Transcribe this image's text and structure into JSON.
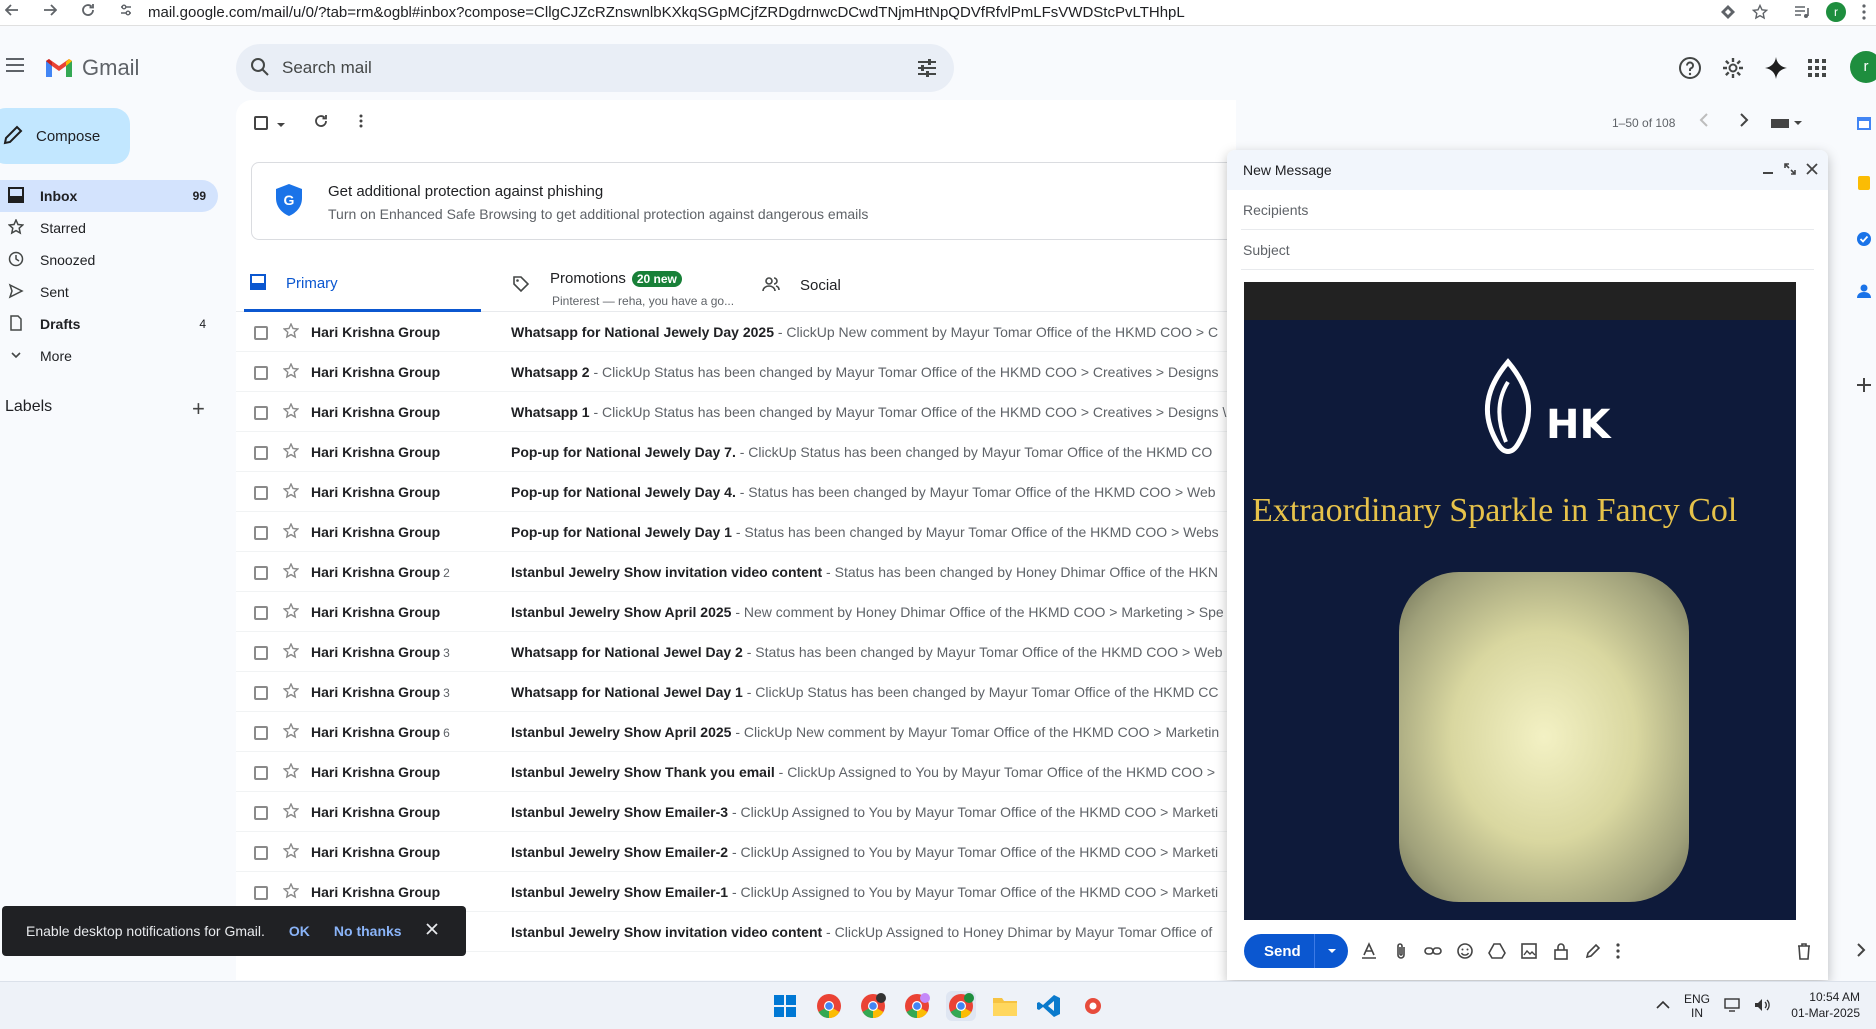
{
  "browser": {
    "url": "mail.google.com/mail/u/0/?tab=rm&ogbl#inbox?compose=CllgCJZcRZnswnlbKXkqSGpMCjfZRDgdrnwcDCwdTNjmHtNpQDVfRfvlPmLFsVWDStcPvLTHhpL",
    "avatar_letter": "r"
  },
  "app": {
    "name": "Gmail",
    "search_placeholder": "Search mail",
    "avatar_letter": "r"
  },
  "sidebar": {
    "compose_label": "Compose",
    "items": [
      {
        "label": "Inbox",
        "count": "99",
        "icon": "inbox-icon"
      },
      {
        "label": "Starred",
        "count": "",
        "icon": "star-icon"
      },
      {
        "label": "Snoozed",
        "count": "",
        "icon": "clock-icon"
      },
      {
        "label": "Sent",
        "count": "",
        "icon": "send-icon"
      },
      {
        "label": "Drafts",
        "count": "4",
        "icon": "draft-icon"
      },
      {
        "label": "More",
        "count": "",
        "icon": "chevron-down-icon"
      }
    ],
    "labels_heading": "Labels"
  },
  "toolbar": {
    "pager": "1–50 of 108"
  },
  "phishing_banner": {
    "title": "Get additional protection against phishing",
    "body": "Turn on Enhanced Safe Browsing to get additional protection against dangerous emails"
  },
  "tabs": {
    "primary": "Primary",
    "promotions": "Promotions",
    "promotions_badge": "20 new",
    "promotions_sub": "Pinterest — reha, you have a go...",
    "social": "Social"
  },
  "emails": [
    {
      "sender": "Hari Krishna Group",
      "count": "",
      "subject": "Whatsapp for National Jewely Day 2025",
      "snippet": " - ClickUp New comment by Mayur Tomar Office of the HKMD COO > C"
    },
    {
      "sender": "Hari Krishna Group",
      "count": "",
      "subject": "Whatsapp 2",
      "snippet": " - ClickUp Status has been changed by Mayur Tomar Office of the HKMD COO > Creatives > Designs"
    },
    {
      "sender": "Hari Krishna Group",
      "count": "",
      "subject": "Whatsapp 1",
      "snippet": " - ClickUp Status has been changed by Mayur Tomar Office of the HKMD COO > Creatives > Designs \\"
    },
    {
      "sender": "Hari Krishna Group",
      "count": "",
      "subject": "Pop-up for National Jewely Day 7.",
      "snippet": " - ClickUp Status has been changed by Mayur Tomar Office of the HKMD CO"
    },
    {
      "sender": "Hari Krishna Group",
      "count": "",
      "subject": "Pop-up for National Jewely Day 4.",
      "snippet": " - Status has been changed by Mayur Tomar Office of the HKMD COO > Web"
    },
    {
      "sender": "Hari Krishna Group",
      "count": "",
      "subject": "Pop-up for National Jewely Day 1",
      "snippet": " - Status has been changed by Mayur Tomar Office of the HKMD COO > Webs"
    },
    {
      "sender": "Hari Krishna Group",
      "count": "2",
      "subject": "Istanbul Jewelry Show invitation video content",
      "snippet": " - Status has been changed by Honey Dhimar Office of the HKN"
    },
    {
      "sender": "Hari Krishna Group",
      "count": "",
      "subject": "Istanbul Jewelry Show April 2025",
      "snippet": " - New comment by Honey Dhimar Office of the HKMD COO > Marketing > Spe"
    },
    {
      "sender": "Hari Krishna Group",
      "count": "3",
      "subject": "Whatsapp for National Jewel Day 2",
      "snippet": " - Status has been changed by Mayur Tomar Office of the HKMD COO > Web"
    },
    {
      "sender": "Hari Krishna Group",
      "count": "3",
      "subject": "Whatsapp for National Jewel Day 1",
      "snippet": " - ClickUp Status has been changed by Mayur Tomar Office of the HKMD CC"
    },
    {
      "sender": "Hari Krishna Group",
      "count": "6",
      "subject": "Istanbul Jewelry Show April 2025",
      "snippet": " - ClickUp New comment by Mayur Tomar Office of the HKMD COO > Marketin"
    },
    {
      "sender": "Hari Krishna Group",
      "count": "",
      "subject": "Istanbul Jewelry Show Thank you email",
      "snippet": " - ClickUp Assigned to You by Mayur Tomar Office of the HKMD COO >"
    },
    {
      "sender": "Hari Krishna Group",
      "count": "",
      "subject": "Istanbul Jewelry Show Emailer-3",
      "snippet": " - ClickUp Assigned to You by Mayur Tomar Office of the HKMD COO > Marketi"
    },
    {
      "sender": "Hari Krishna Group",
      "count": "",
      "subject": "Istanbul Jewelry Show Emailer-2",
      "snippet": " - ClickUp Assigned to You by Mayur Tomar Office of the HKMD COO > Marketi"
    },
    {
      "sender": "Hari Krishna Group",
      "count": "",
      "subject": "Istanbul Jewelry Show Emailer-1",
      "snippet": " - ClickUp Assigned to You by Mayur Tomar Office of the HKMD COO > Marketi"
    },
    {
      "sender": "Hari Krishna Group",
      "count": "",
      "subject": "Istanbul Jewelry Show invitation video content",
      "snippet": " - ClickUp Assigned to Honey Dhimar by Mayur Tomar Office of"
    }
  ],
  "compose_window": {
    "title": "New Message",
    "recipients_placeholder": "Recipients",
    "subject_placeholder": "Subject",
    "image_brand": "HK",
    "image_tagline": "Extraordinary Sparkle in Fancy Col",
    "send_label": "Send"
  },
  "snackbar": {
    "message": "Enable desktop notifications for Gmail.",
    "ok": "OK",
    "no_thanks": "No thanks"
  },
  "taskbar": {
    "lang_top": "ENG",
    "lang_bottom": "IN",
    "time": "10:54 AM",
    "date": "01-Mar-2025"
  },
  "colors": {
    "accent": "#0b57d0",
    "compose_bg": "#c2e7ff",
    "active_nav": "#d3e3fd",
    "promo_badge": "#188038"
  }
}
